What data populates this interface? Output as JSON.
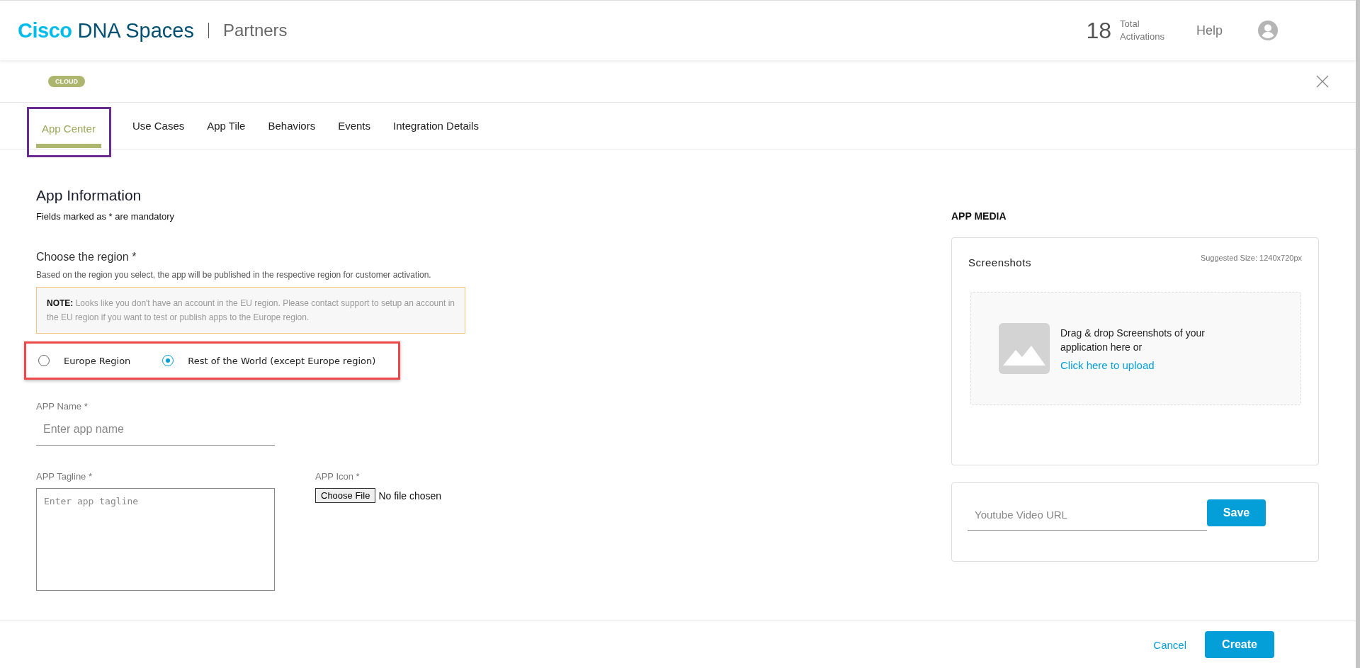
{
  "header": {
    "brand_primary": "Cisco",
    "brand_secondary": "DNA Spaces",
    "product": "Partners",
    "activations": {
      "count": "18",
      "label_top": "Total",
      "label_bottom": "Activations"
    },
    "help": "Help"
  },
  "badge": "CLOUD",
  "tabs": [
    {
      "label": "App Center",
      "selected": true,
      "highlighted": true
    },
    {
      "label": "Use Cases",
      "selected": false,
      "highlighted": false
    },
    {
      "label": "App Tile",
      "selected": false,
      "highlighted": false
    },
    {
      "label": "Behaviors",
      "selected": false,
      "highlighted": false
    },
    {
      "label": "Events",
      "selected": false,
      "highlighted": false
    },
    {
      "label": "Integration Details",
      "selected": false,
      "highlighted": false
    }
  ],
  "form": {
    "title": "App Information",
    "subtitle": "Fields marked as * are mandatory",
    "region": {
      "label": "Choose the region *",
      "description": "Based on the region you select, the app will be published in the respective region for customer activation.",
      "note": "**NOTE:** Looks like you don't have an account in the EU region. Please contact support to setup an account in the EU region if you want to test or publish apps to the Europe region.",
      "highlighted": true,
      "options": [
        {
          "label": "Europe Region",
          "selected": false
        },
        {
          "label": "Rest of the World (except Europe region)",
          "selected": true
        }
      ]
    },
    "app_name": {
      "label": "APP Name *",
      "placeholder": "Enter app name"
    },
    "tagline": {
      "label": "APP Tagline *",
      "placeholder": "Enter app tagline"
    },
    "icon": {
      "label": "APP Icon *",
      "button": "Choose File",
      "status": "No file chosen"
    }
  },
  "media": {
    "heading": "APP MEDIA",
    "screenshots": {
      "title": "Screenshots",
      "suggested_size": "Suggested Size: 1240x720px",
      "drop_text": "Drag & drop Screenshots of your application here or",
      "upload_link": "Click here to upload"
    },
    "video": {
      "placeholder": "Youtube Video URL",
      "button": "Save"
    }
  },
  "footer": {
    "cancel": "Cancel",
    "create": "Create"
  }
}
